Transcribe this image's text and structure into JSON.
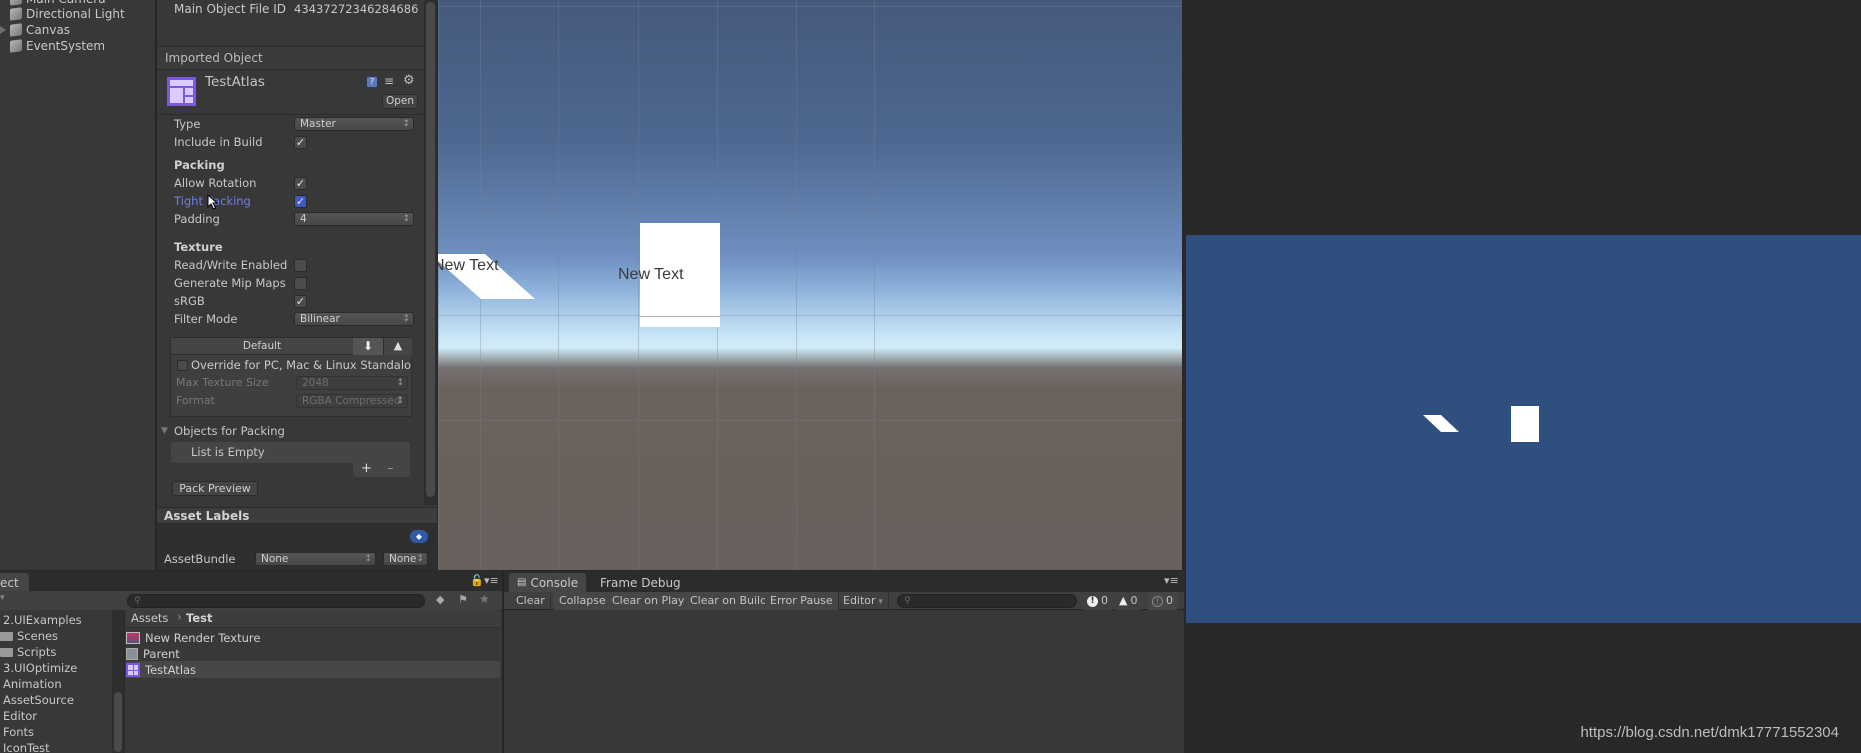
{
  "hierarchy": {
    "items": [
      {
        "label": "Main Camera",
        "has_children": false
      },
      {
        "label": "Directional Light",
        "has_children": false
      },
      {
        "label": "Canvas",
        "has_children": true
      },
      {
        "label": "EventSystem",
        "has_children": false
      }
    ]
  },
  "inspector": {
    "main_object_file_id_label": "Main Object File ID",
    "main_object_file_id_value": "43437272346284686",
    "imported_object_header": "Imported Object",
    "asset_name": "TestAtlas",
    "open_button": "Open",
    "icons": [
      "help-icon",
      "preset-icon",
      "gear-icon"
    ],
    "fields": {
      "type": {
        "label": "Type",
        "value": "Master"
      },
      "include_in_build": {
        "label": "Include in Build",
        "checked": true
      },
      "packing_header": "Packing",
      "allow_rotation": {
        "label": "Allow Rotation",
        "checked": true
      },
      "tight_packing": {
        "label": "Tight Packing",
        "checked": true
      },
      "padding": {
        "label": "Padding",
        "value": "4"
      },
      "texture_header": "Texture",
      "read_write": {
        "label": "Read/Write Enabled",
        "checked": false
      },
      "mip_maps": {
        "label": "Generate Mip Maps",
        "checked": false
      },
      "srgb": {
        "label": "sRGB",
        "checked": true
      },
      "filter_mode": {
        "label": "Filter Mode",
        "value": "Bilinear"
      }
    },
    "platform_tabs": {
      "default_label": "Default",
      "icons": [
        "download-icon",
        "android-icon"
      ]
    },
    "override": {
      "label": "Override for PC, Mac & Linux Standalo",
      "checked": false
    },
    "max_texture_size": {
      "label": "Max Texture Size",
      "value": "2048"
    },
    "format": {
      "label": "Format",
      "value": "RGBA Compressed"
    },
    "objects_for_packing": {
      "label": "Objects for Packing",
      "empty_text": "List is Empty",
      "add": "+",
      "remove": "–"
    },
    "pack_preview_button": "Pack Preview",
    "asset_labels_header": "Asset Labels",
    "asset_bundle": {
      "label": "AssetBundle",
      "value": "None",
      "variant": "None"
    }
  },
  "scene": {
    "texts": [
      "New Text",
      "New Text"
    ]
  },
  "project": {
    "tab_label": "ect",
    "create_label": "▾",
    "tree": [
      {
        "label": "2.UIExamples",
        "folder": false
      },
      {
        "label": "Scenes",
        "folder": true
      },
      {
        "label": "Scripts",
        "folder": true
      },
      {
        "label": "3.UIOptimize",
        "folder": false
      },
      {
        "label": "Animation",
        "folder": false
      },
      {
        "label": "AssetSource",
        "folder": false
      },
      {
        "label": "Editor",
        "folder": false
      },
      {
        "label": "Fonts",
        "folder": false
      },
      {
        "label": "IconTest",
        "folder": false
      }
    ],
    "breadcrumb": {
      "root": "Assets",
      "separator": "›",
      "current": "Test"
    },
    "files": [
      {
        "label": "New Render Texture",
        "icon": "render-texture-icon",
        "selected": false
      },
      {
        "label": "Parent",
        "icon": "prefab-icon",
        "selected": false
      },
      {
        "label": "TestAtlas",
        "icon": "sprite-atlas-icon",
        "selected": true
      }
    ]
  },
  "console": {
    "tabs": [
      "Console",
      "Frame Debug"
    ],
    "buttons": [
      "Clear",
      "Collapse",
      "Clear on Play",
      "Clear on Build",
      "Error Pause",
      "Editor"
    ],
    "counts": {
      "errors": "0",
      "warnings": "0",
      "messages": "0"
    }
  },
  "watermark": "https://blog.csdn.net/dmk17771552304"
}
